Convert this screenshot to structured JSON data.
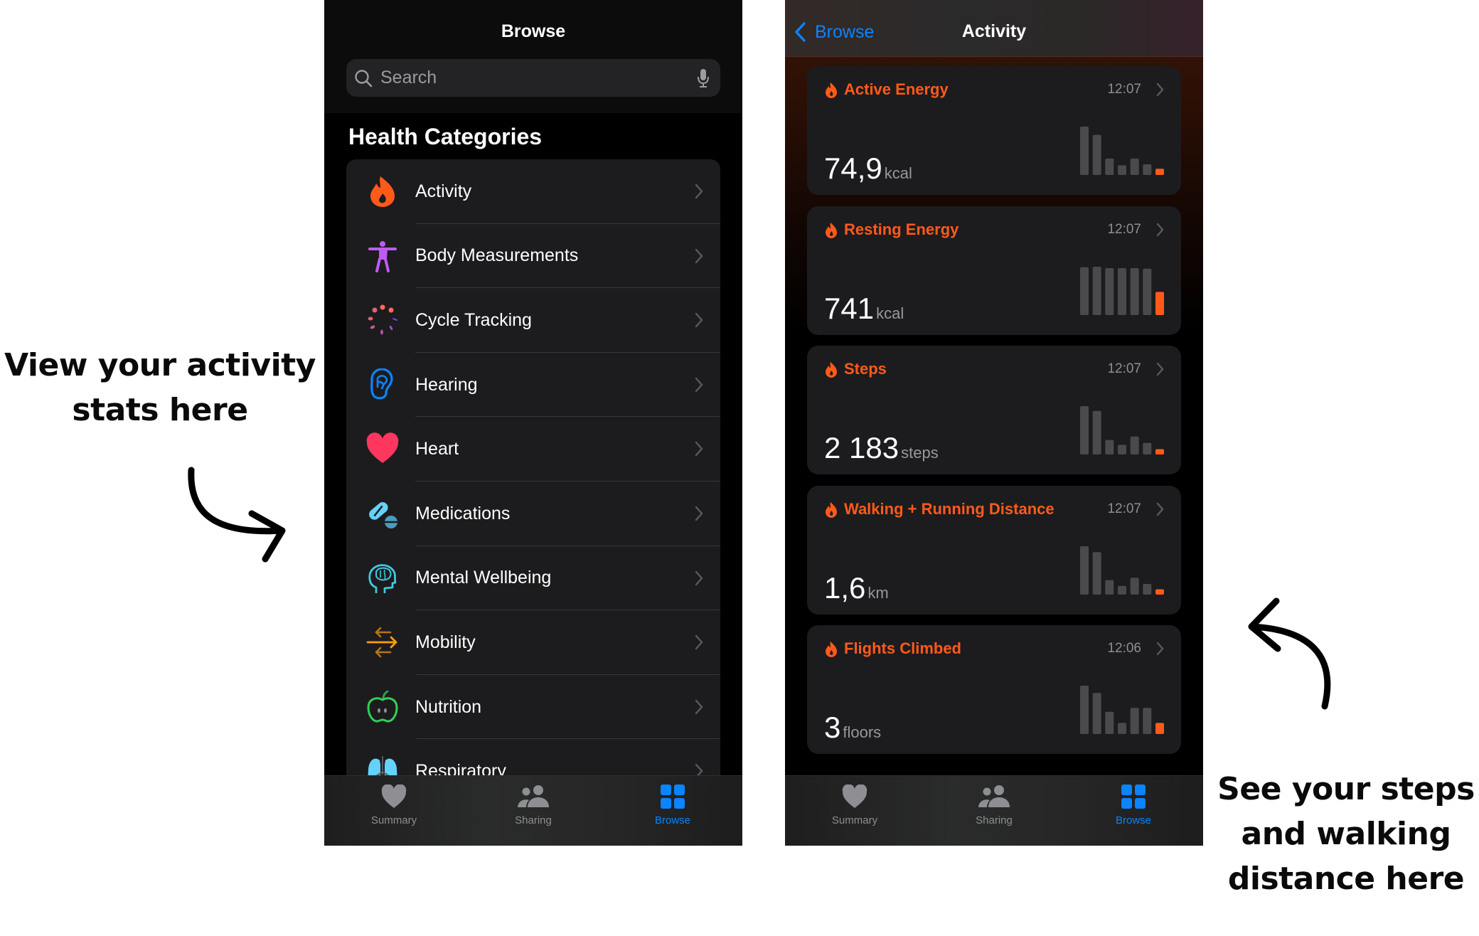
{
  "annotations": {
    "left": [
      "View your activity",
      "stats here"
    ],
    "right": [
      "See your steps",
      "and walking",
      "distance here"
    ]
  },
  "left_phone": {
    "nav_title": "Browse",
    "search": {
      "placeholder": "Search",
      "value": ""
    },
    "section_title": "Health Categories",
    "categories": [
      {
        "label": "Activity",
        "icon": "flame-icon",
        "color": "#ff5a1a"
      },
      {
        "label": "Body Measurements",
        "icon": "body-figure-icon",
        "color": "#bf5af2"
      },
      {
        "label": "Cycle Tracking",
        "icon": "cycle-dots-icon",
        "color": "#ff6961"
      },
      {
        "label": "Hearing",
        "icon": "ear-icon",
        "color": "#0a84ff"
      },
      {
        "label": "Heart",
        "icon": "heart-icon",
        "color": "#ff375f"
      },
      {
        "label": "Medications",
        "icon": "pills-icon",
        "color": "#64d2ff"
      },
      {
        "label": "Mental Wellbeing",
        "icon": "head-brain-icon",
        "color": "#40c8e0"
      },
      {
        "label": "Mobility",
        "icon": "arrows-icon",
        "color": "#ff9f0a"
      },
      {
        "label": "Nutrition",
        "icon": "apple-icon",
        "color": "#30d158"
      },
      {
        "label": "Respiratory",
        "icon": "lungs-icon",
        "color": "#64d2ff"
      }
    ],
    "tabs": [
      {
        "label": "Summary",
        "icon": "heart-icon",
        "active": false
      },
      {
        "label": "Sharing",
        "icon": "people-icon",
        "active": false
      },
      {
        "label": "Browse",
        "icon": "grid-icon",
        "active": true
      }
    ]
  },
  "right_phone": {
    "back_label": "Browse",
    "nav_title": "Activity",
    "accent": "#ff5a1a",
    "cards": [
      {
        "title": "Active Energy",
        "time": "12:07",
        "value": "74,9",
        "unit": "kcal",
        "bars": [
          1.0,
          0.83,
          0.34,
          0.2,
          0.34,
          0.22,
          0.13
        ]
      },
      {
        "title": "Resting Energy",
        "time": "12:07",
        "value": "741",
        "unit": "kcal",
        "bars": [
          0.99,
          1.0,
          0.97,
          0.97,
          0.97,
          0.96,
          0.48
        ]
      },
      {
        "title": "Steps",
        "time": "12:07",
        "value": "2 183",
        "unit": "steps",
        "bars": [
          1.0,
          0.9,
          0.3,
          0.2,
          0.37,
          0.24,
          0.11
        ]
      },
      {
        "title": "Walking + Running Distance",
        "time": "12:07",
        "value": "1,6",
        "unit": "km",
        "bars": [
          1.0,
          0.88,
          0.3,
          0.18,
          0.35,
          0.22,
          0.11
        ]
      },
      {
        "title": "Flights Climbed",
        "time": "12:06",
        "value": "3",
        "unit": "floors",
        "bars": [
          1.0,
          0.85,
          0.46,
          0.23,
          0.54,
          0.54,
          0.23
        ]
      }
    ],
    "tabs": [
      {
        "label": "Summary",
        "icon": "heart-icon",
        "active": false
      },
      {
        "label": "Sharing",
        "icon": "people-icon",
        "active": false
      },
      {
        "label": "Browse",
        "icon": "grid-icon",
        "active": true
      }
    ]
  }
}
